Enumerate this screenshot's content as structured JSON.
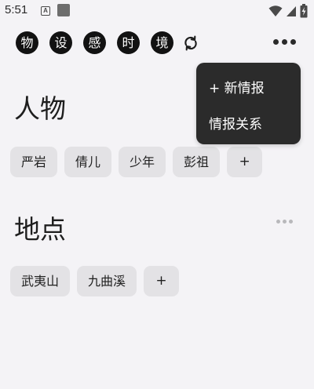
{
  "status_bar": {
    "time": "5:51",
    "a_icon_label": "A",
    "icons": [
      "a-icon",
      "square-icon",
      "wifi-icon",
      "signal-icon",
      "battery-charging-icon"
    ]
  },
  "categories": [
    "物",
    "设",
    "感",
    "时",
    "境"
  ],
  "toolbar": {
    "refresh_icon": "refresh-icon",
    "more_icon": "more-horizontal-icon"
  },
  "menu": {
    "items": [
      "+ 新情报",
      "情报关系"
    ]
  },
  "sections": {
    "people": {
      "title": "人物",
      "tags": [
        "严岩",
        "倩儿",
        "少年",
        "彭祖"
      ],
      "add_label": "+"
    },
    "places": {
      "title": "地点",
      "tags": [
        "武夷山",
        "九曲溪"
      ],
      "add_label": "+"
    }
  },
  "colors": {
    "background": "#f4f3f6",
    "chip_dark": "#121212",
    "tag_bg": "#e3e2e5",
    "menu_bg": "#2b2b2b"
  }
}
